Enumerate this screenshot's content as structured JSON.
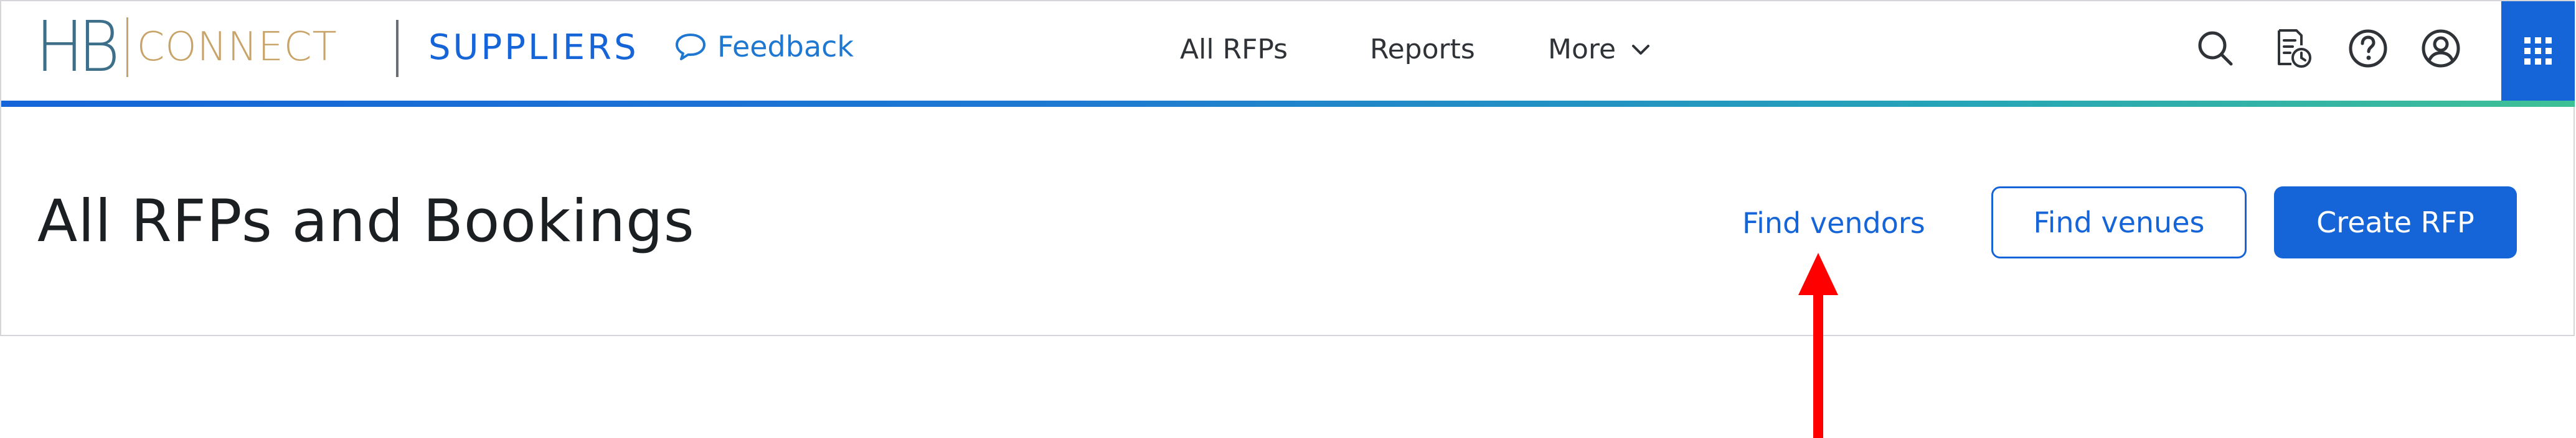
{
  "branding": {
    "logo_hb": "HB",
    "logo_connect": "CONNECT",
    "section_title": "SUPPLIERS"
  },
  "header": {
    "feedback_label": "Feedback",
    "nav": {
      "all_rfps": "All RFPs",
      "reports": "Reports",
      "more": "More"
    },
    "icons": [
      "search-icon",
      "rfp-history-icon",
      "help-icon",
      "account-icon",
      "apps-grid-icon"
    ]
  },
  "page": {
    "title": "All RFPs and Bookings",
    "find_vendors_label": "Find vendors",
    "find_venues_label": "Find venues",
    "create_rfp_label": "Create RFP"
  },
  "colors": {
    "primary": "#1565d8",
    "logo_hb": "#3e6f89",
    "logo_connect": "#c9a46a",
    "annotation_arrow": "#ff0000",
    "gradient_end": "#3fc196"
  }
}
